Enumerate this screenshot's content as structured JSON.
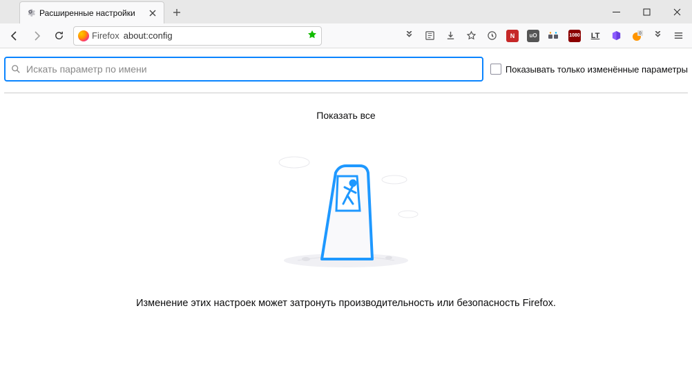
{
  "tab": {
    "title": "Расширенные настройки"
  },
  "urlbar": {
    "identity": "Firefox",
    "url": "about:config"
  },
  "search": {
    "placeholder": "Искать параметр по имени"
  },
  "checkbox": {
    "label": "Показывать только изменённые параметры"
  },
  "show_all": "Показать все",
  "warning": "Изменение этих настроек может затронуть производительность или безопасность Firefox."
}
